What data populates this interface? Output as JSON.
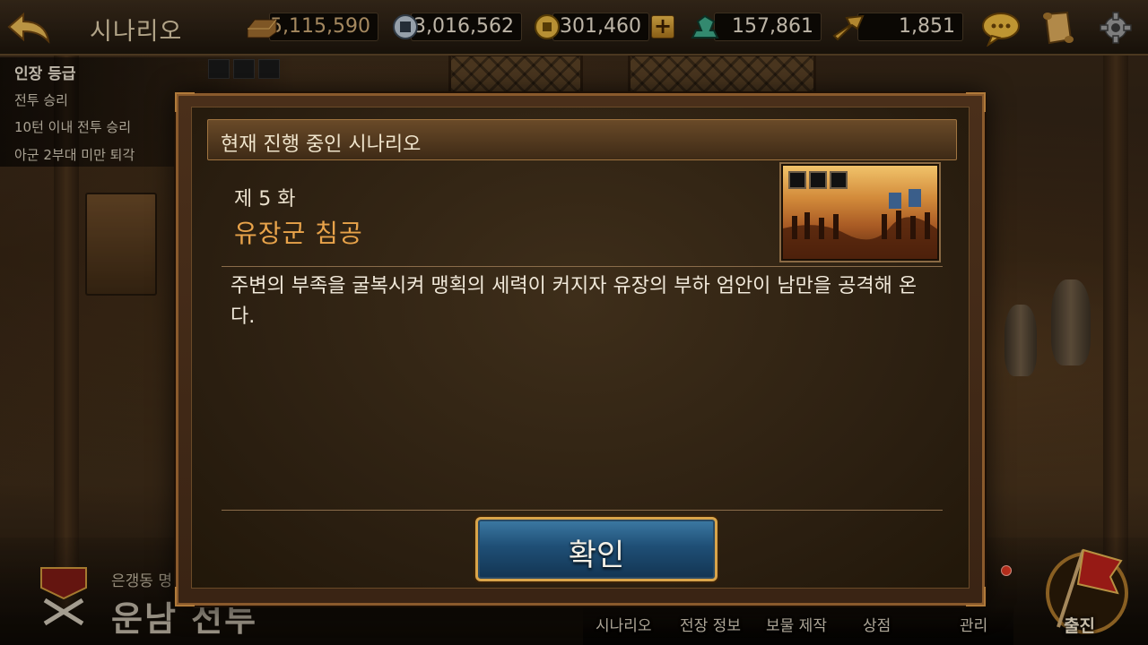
{
  "topbar": {
    "back_icon": "back-arrow-icon",
    "title": "시나리오",
    "resources": {
      "gold_bars": "5,115,590",
      "silver": "3,016,562",
      "coins": "301,460",
      "jade": "157,861",
      "scrolls": "1,851"
    },
    "plus_label": "+",
    "icons": [
      "chat-bubble-icon",
      "scroll-icon",
      "settings-gear-icon"
    ]
  },
  "quests": {
    "header": "인장 등급",
    "items": [
      "전투 승리",
      "10턴 이내 전투 승리",
      "아군 2부대 미만 퇴각"
    ]
  },
  "battle": {
    "location": "은갱동 명",
    "name": "운남 전투"
  },
  "nav": {
    "scenario": "시나리오",
    "battle_info": "전장 정보",
    "treasure": "보물 제작",
    "shop": "상점",
    "manage": "관리",
    "sortie": "출진"
  },
  "dialog": {
    "title": "현재 진행 중인 시나리오",
    "chapter": "제 5 화",
    "scenario_name": "유장군 침공",
    "description": "주변의 부족을 굴복시켜 맹획의 세력이 커지자 유장의 부하 엄안이 남만을 공격해 온다.",
    "confirm": "확인"
  },
  "colors": {
    "scenario_name": "#e8a34a",
    "confirm_button": "#1f4f76",
    "dialog_border": "#8a5a2c"
  }
}
